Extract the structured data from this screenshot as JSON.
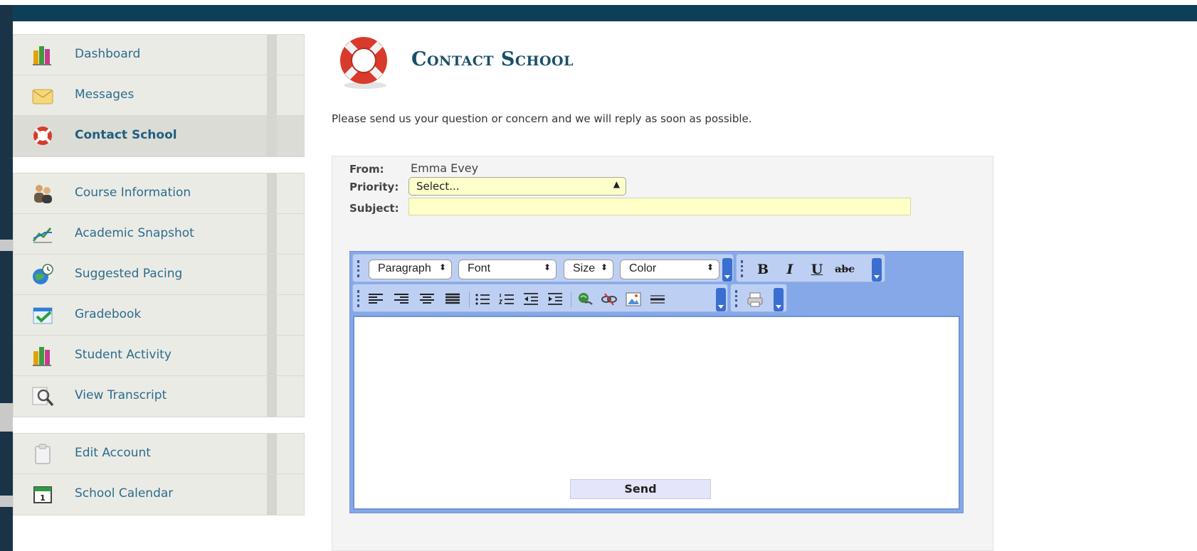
{
  "sidebar": {
    "items": [
      {
        "label": "Dashboard",
        "icon": "bar-chart-icon"
      },
      {
        "label": "Messages",
        "icon": "envelope-icon"
      },
      {
        "label": "Contact School",
        "icon": "lifebuoy-icon"
      },
      {
        "label": "Course Information",
        "icon": "users-icon"
      },
      {
        "label": "Academic Snapshot",
        "icon": "line-chart-icon"
      },
      {
        "label": "Suggested Pacing",
        "icon": "globe-clock-icon"
      },
      {
        "label": "Gradebook",
        "icon": "checkbook-icon"
      },
      {
        "label": "Student Activity",
        "icon": "bar-chart-icon"
      },
      {
        "label": "View Transcript",
        "icon": "magnifier-icon"
      },
      {
        "label": "Edit Account",
        "icon": "clipboard-icon"
      },
      {
        "label": "School Calendar",
        "icon": "calendar-icon"
      }
    ],
    "active": "Contact School",
    "calendar_day": "1"
  },
  "page": {
    "title": "Contact School",
    "intro": "Please send us your question or concern and we will reply as soon as possible."
  },
  "form": {
    "from_label": "From:",
    "from_value": "Emma Evey",
    "priority_label": "Priority:",
    "priority_value": "Select...",
    "subject_label": "Subject:",
    "subject_value": "",
    "send_label": "Send"
  },
  "editor": {
    "format_select": "Paragraph",
    "font_select": "Font",
    "size_select": "Size",
    "color_select": "Color",
    "bold": "B",
    "italic": "I",
    "underline": "U",
    "strike": "abc",
    "body": ""
  },
  "colors": {
    "header_band": "#0d4058",
    "sidebar_bg": "#ebebe6",
    "nav_text": "#2b6c8c",
    "title_text": "#1a4f68",
    "toolbar_bg": "#85a8e8",
    "field_bg": "#ffffcc",
    "send_bg": "#e4e4fa"
  }
}
